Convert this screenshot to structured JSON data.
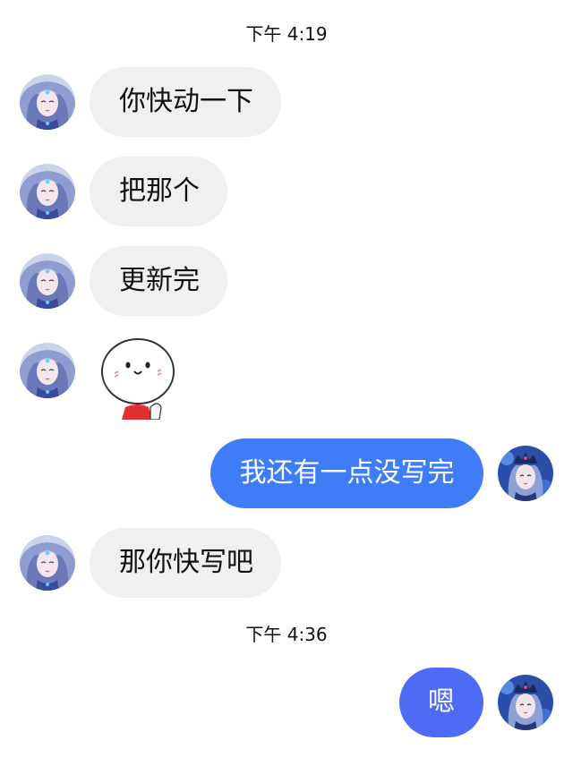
{
  "timestamps": [
    "下午 4:19",
    "下午 4:36"
  ],
  "messages": [
    {
      "side": "in",
      "text": "你快动一下"
    },
    {
      "side": "in",
      "text": "把那个"
    },
    {
      "side": "in",
      "text": "更新完"
    },
    {
      "side": "in",
      "type": "sticker",
      "sticker": "smiling-face-sticker"
    },
    {
      "side": "out",
      "text": "我还有一点没写完"
    },
    {
      "side": "in",
      "text": "那你快写吧"
    },
    {
      "side": "out",
      "text": "嗯"
    }
  ],
  "colors": {
    "incoming_bubble": "#f0f0f0",
    "outgoing_bubble": "#3f7df6",
    "outgoing_bubble_short": "#4f6bf5",
    "text_dark": "#111111"
  }
}
